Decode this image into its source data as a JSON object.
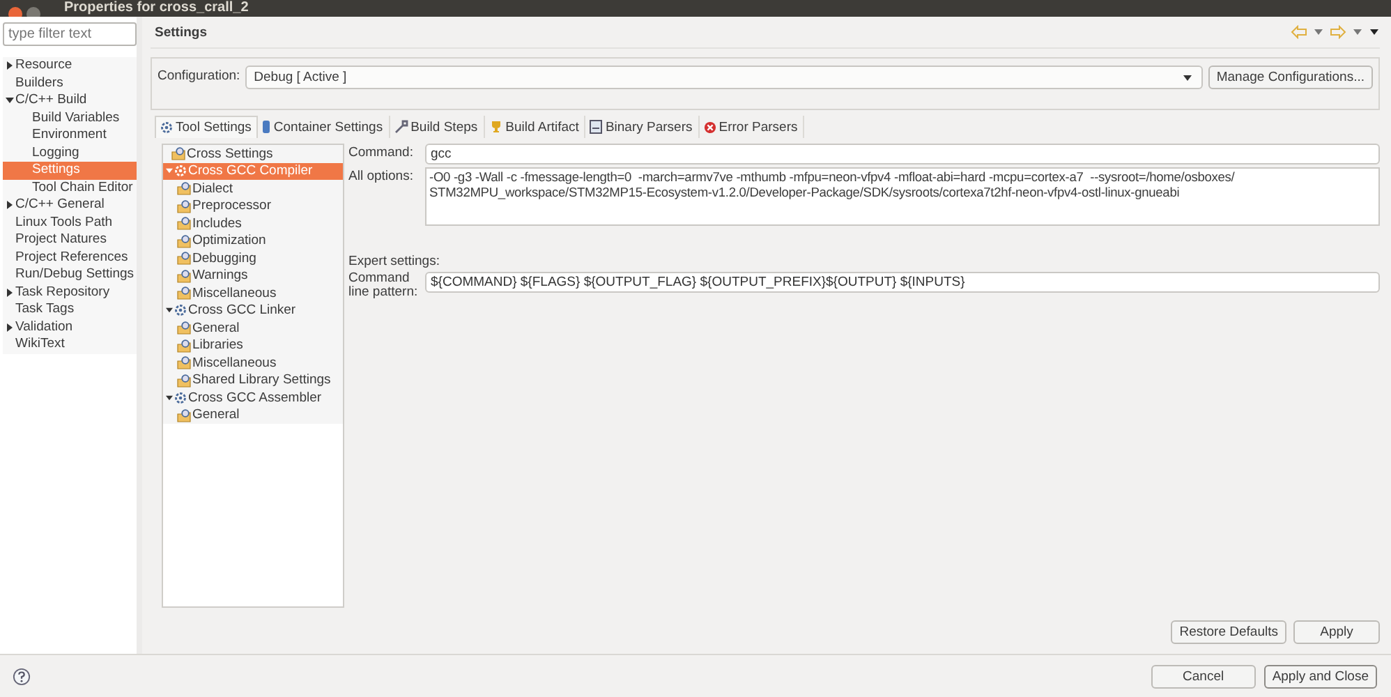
{
  "window": {
    "title": "Properties for cross_crall_2"
  },
  "filter": {
    "placeholder": "type filter text"
  },
  "sidebar": {
    "items": [
      {
        "label": "Resource",
        "expanded": false,
        "selected": false
      },
      {
        "label": "Builders",
        "selected": false
      },
      {
        "label": "C/C++ Build",
        "expanded": true,
        "selected": false,
        "children": [
          {
            "label": "Build Variables",
            "selected": false
          },
          {
            "label": "Environment",
            "selected": false
          },
          {
            "label": "Logging",
            "selected": false
          },
          {
            "label": "Settings",
            "selected": true
          },
          {
            "label": "Tool Chain Editor",
            "selected": false
          }
        ]
      },
      {
        "label": "C/C++ General",
        "expanded": false,
        "selected": false
      },
      {
        "label": "Linux Tools Path",
        "selected": false
      },
      {
        "label": "Project Natures",
        "selected": false
      },
      {
        "label": "Project References",
        "selected": false
      },
      {
        "label": "Run/Debug Settings",
        "selected": false
      },
      {
        "label": "Task Repository",
        "expanded": false,
        "selected": false
      },
      {
        "label": "Task Tags",
        "selected": false
      },
      {
        "label": "Validation",
        "expanded": false,
        "selected": false
      },
      {
        "label": "WikiText",
        "selected": false
      }
    ]
  },
  "page": {
    "title": "Settings",
    "configuration_label": "Configuration:",
    "configuration_value": "Debug  [ Active ]",
    "manage_button": "Manage Configurations..."
  },
  "tabs": [
    {
      "label": "Tool Settings",
      "selected": true
    },
    {
      "label": "Container Settings",
      "selected": false
    },
    {
      "label": "Build Steps",
      "selected": false
    },
    {
      "label": "Build Artifact",
      "selected": false
    },
    {
      "label": "Binary Parsers",
      "selected": false
    },
    {
      "label": "Error Parsers",
      "selected": false
    }
  ],
  "tool_tree": [
    {
      "label": "Cross Settings",
      "kind": "option",
      "selected": false
    },
    {
      "label": "Cross GCC Compiler",
      "kind": "tool",
      "expanded": true,
      "selected": true,
      "children": [
        {
          "label": "Dialect",
          "kind": "option",
          "selected": false
        },
        {
          "label": "Preprocessor",
          "kind": "option",
          "selected": false
        },
        {
          "label": "Includes",
          "kind": "option",
          "selected": false
        },
        {
          "label": "Optimization",
          "kind": "option",
          "selected": false
        },
        {
          "label": "Debugging",
          "kind": "option",
          "selected": false
        },
        {
          "label": "Warnings",
          "kind": "option",
          "selected": false
        },
        {
          "label": "Miscellaneous",
          "kind": "option",
          "selected": false
        }
      ]
    },
    {
      "label": "Cross GCC Linker",
      "kind": "tool",
      "expanded": true,
      "selected": false,
      "children": [
        {
          "label": "General",
          "kind": "option",
          "selected": false
        },
        {
          "label": "Libraries",
          "kind": "option",
          "selected": false
        },
        {
          "label": "Miscellaneous",
          "kind": "option",
          "selected": false
        },
        {
          "label": "Shared Library Settings",
          "kind": "option",
          "selected": false
        }
      ]
    },
    {
      "label": "Cross GCC Assembler",
      "kind": "tool",
      "expanded": true,
      "selected": false,
      "children": [
        {
          "label": "General",
          "kind": "option",
          "selected": false
        }
      ]
    }
  ],
  "form": {
    "command_label": "Command:",
    "command_value": "gcc",
    "options_label": "All options:",
    "options_value": "-O0 -g3 -Wall -c -fmessage-length=0  -march=armv7ve -mthumb -mfpu=neon-vfpv4 -mfloat-abi=hard -mcpu=cortex-a7  --sysroot=/home/osboxes/\nSTM32MPU_workspace/STM32MP15-Ecosystem-v1.2.0/Developer-Package/SDK/sysroots/cortexa7t2hf-neon-vfpv4-ostl-linux-gnueabi",
    "expert_label": "Expert settings:",
    "pattern_label": "Command line pattern:",
    "pattern_value": "${COMMAND} ${FLAGS} ${OUTPUT_FLAG} ${OUTPUT_PREFIX}${OUTPUT} ${INPUTS}"
  },
  "page_buttons": [
    "Restore Defaults",
    "Apply"
  ],
  "dialog_buttons": [
    "Cancel",
    "Apply and Close"
  ]
}
